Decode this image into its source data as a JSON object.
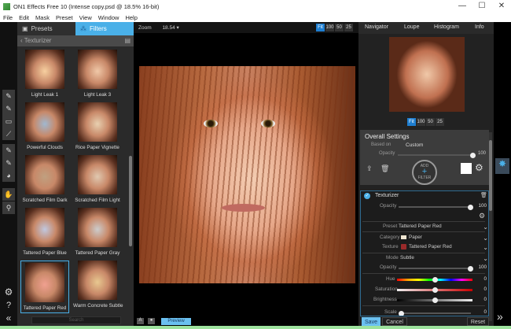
{
  "window": {
    "title": "ON1 Effects Free 10 (Intense copy.psd @ 18.5% 16-bit)",
    "min": "—",
    "max": "☐",
    "close": "✕"
  },
  "menu": [
    "File",
    "Edit",
    "Mask",
    "Preset",
    "View",
    "Window",
    "Help"
  ],
  "left_panel": {
    "tabs": {
      "presets": "Presets",
      "filters": "Filters"
    },
    "category": "Texturizer",
    "search_placeholder": "Search",
    "thumbnails": [
      "Light Leak 1",
      "Light Leak 3",
      "Powerful Clouds",
      "Rice Paper Vignette",
      "Scratched Film Dark",
      "Scratched Film Light",
      "Tattered Paper Blue",
      "Tattered Paper Gray",
      "Tattered Paper Red",
      "Warm Concrete Subtle"
    ],
    "selected": "Tattered Paper Red"
  },
  "canvas": {
    "zoom_label": "Zoom",
    "zoom_value": "18.54",
    "zoom_buttons": [
      "Fit",
      "100",
      "50",
      "25"
    ],
    "preview_label": "Preview"
  },
  "right_panel": {
    "tabs": [
      "Navigator",
      "Loupe",
      "Histogram",
      "Info"
    ],
    "nav_zoom_buttons": [
      "Fit",
      "100",
      "50",
      "25"
    ],
    "overall": {
      "title": "Overall Settings",
      "based_on_label": "Based on",
      "based_on": "Custom",
      "opacity_label": "Opacity",
      "opacity": "100",
      "opacity_fraction": 1.0,
      "add_filter": [
        "ADD",
        "FILTER"
      ]
    },
    "filter": {
      "name": "Texturizer",
      "opacity_label": "Opacity",
      "opacity": "100",
      "preset_label": "Preset",
      "preset": "Tattered Paper Red",
      "category_label": "Category",
      "category": "Paper",
      "texture_label": "Texture",
      "texture": "Tattered Paper Red",
      "mode_label": "Mode",
      "mode": "Subtle",
      "opacity2": "100",
      "hue_label": "Hue",
      "hue": "0",
      "saturation_label": "Saturation",
      "saturation": "0",
      "brightness_label": "Brightness",
      "brightness": "0",
      "scale_label": "Scale",
      "scale": "0"
    },
    "buttons": {
      "save": "Save",
      "cancel": "Cancel",
      "reset": "Reset"
    }
  },
  "colors": {
    "accent": "#4ab0e8",
    "category_swatch": "#efe6d2",
    "texture_swatch": "#9a2a2a"
  }
}
